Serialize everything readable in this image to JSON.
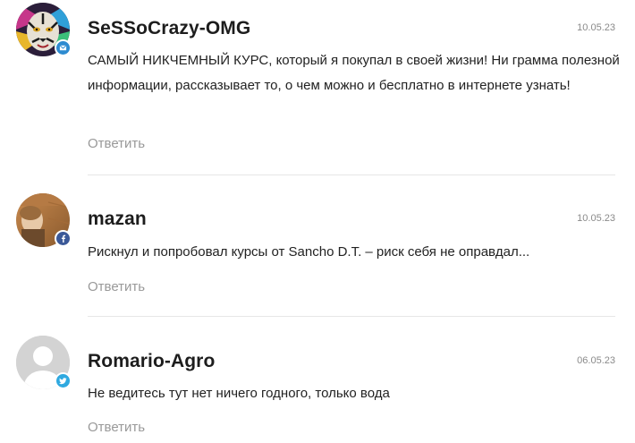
{
  "comments": [
    {
      "author": "SeSSoCrazy-OMG",
      "date": "10.05.23",
      "text": "САМЫЙ НИКЧЕМНЫЙ КУРС, который я покупал в своей жизни! Ни грамма полезной информации, рассказывает то, о чем можно и бесплатно в интернете узнать!",
      "reply_label": "Ответить",
      "avatar_icon": "tiger-avatar-icon",
      "badge_icon": "mail-icon",
      "badge_color": "#2d8bd0"
    },
    {
      "author": "mazan",
      "date": "10.05.23",
      "text": "Рискнул и попробовал курсы от Sancho D.T. – риск себя не оправдал...",
      "reply_label": "Ответить",
      "avatar_icon": "user-photo-avatar-icon",
      "badge_icon": "facebook-icon",
      "badge_color": "#3b5998"
    },
    {
      "author": "Romario-Agro",
      "date": "06.05.23",
      "text": "Не ведитесь тут нет ничего годного, только вода",
      "reply_label": "Ответить",
      "avatar_icon": "default-user-avatar-icon",
      "badge_icon": "twitter-icon",
      "badge_color": "#2fa9e0"
    }
  ]
}
